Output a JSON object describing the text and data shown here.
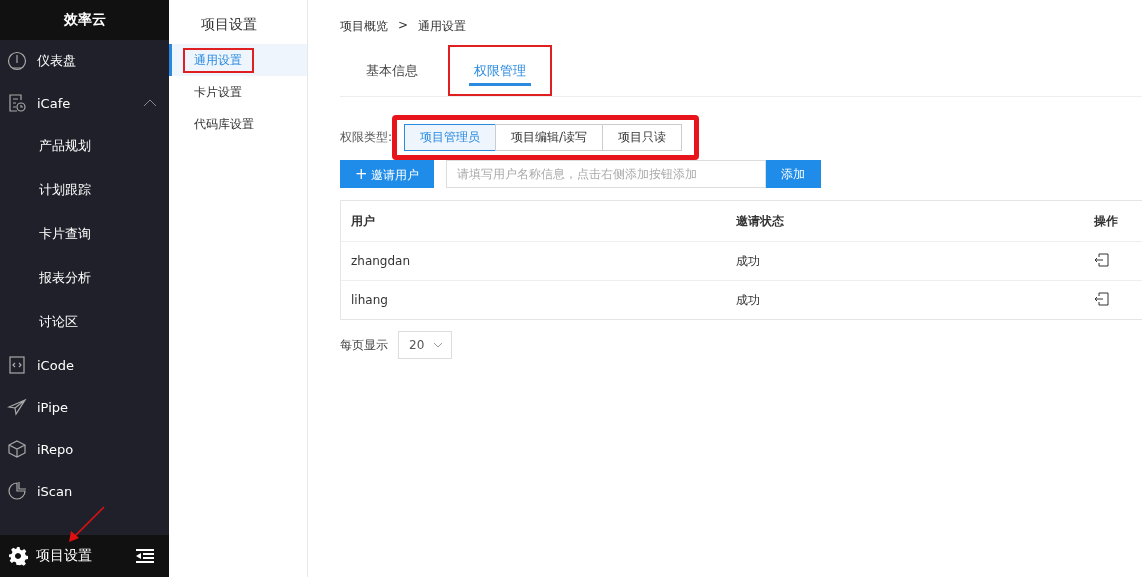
{
  "brand": "效率云",
  "nav": [
    {
      "kind": "item",
      "label": "仪表盘"
    },
    {
      "kind": "group",
      "label": "iCafe",
      "expanded": true,
      "children": [
        {
          "label": "产品规划"
        },
        {
          "label": "计划跟踪"
        },
        {
          "label": "卡片查询"
        },
        {
          "label": "报表分析"
        },
        {
          "label": "讨论区"
        }
      ]
    },
    {
      "kind": "item",
      "label": "iCode"
    },
    {
      "kind": "item",
      "label": "iPipe"
    },
    {
      "kind": "item",
      "label": "iRepo"
    },
    {
      "kind": "item",
      "label": "iScan"
    }
  ],
  "footer": {
    "label": "项目设置"
  },
  "settings_menu": {
    "title": "项目设置",
    "items": [
      {
        "label": "通用设置",
        "selected": true,
        "annotated": true
      },
      {
        "label": "卡片设置",
        "selected": false,
        "annotated": false
      },
      {
        "label": "代码库设置",
        "selected": false,
        "annotated": false
      }
    ]
  },
  "breadcrumb": [
    "项目概览",
    "通用设置"
  ],
  "breadcrumb_separator": ">",
  "tabs": [
    {
      "label": "基本信息",
      "selected": false,
      "annotated": false
    },
    {
      "label": "权限管理",
      "selected": true,
      "annotated": true
    }
  ],
  "permission": {
    "label": "权限类型:",
    "annotated": true,
    "options": [
      {
        "label": "项目管理员",
        "selected": true
      },
      {
        "label": "项目编辑/读写",
        "selected": false
      },
      {
        "label": "项目只读",
        "selected": false
      }
    ]
  },
  "invite_button": {
    "icon": "+",
    "label": "邀请用户"
  },
  "user_field": {
    "placeholder": "请填写用户名称信息，点击右侧添加按钮添加"
  },
  "add_button": "添加",
  "table": {
    "columns": [
      "用户",
      "邀请状态",
      "操作"
    ],
    "rows": [
      {
        "user": "zhangdan",
        "status": "成功"
      },
      {
        "user": "lihang",
        "status": "成功"
      }
    ]
  },
  "pagination": {
    "label": "每页显示",
    "page_size": "20"
  }
}
